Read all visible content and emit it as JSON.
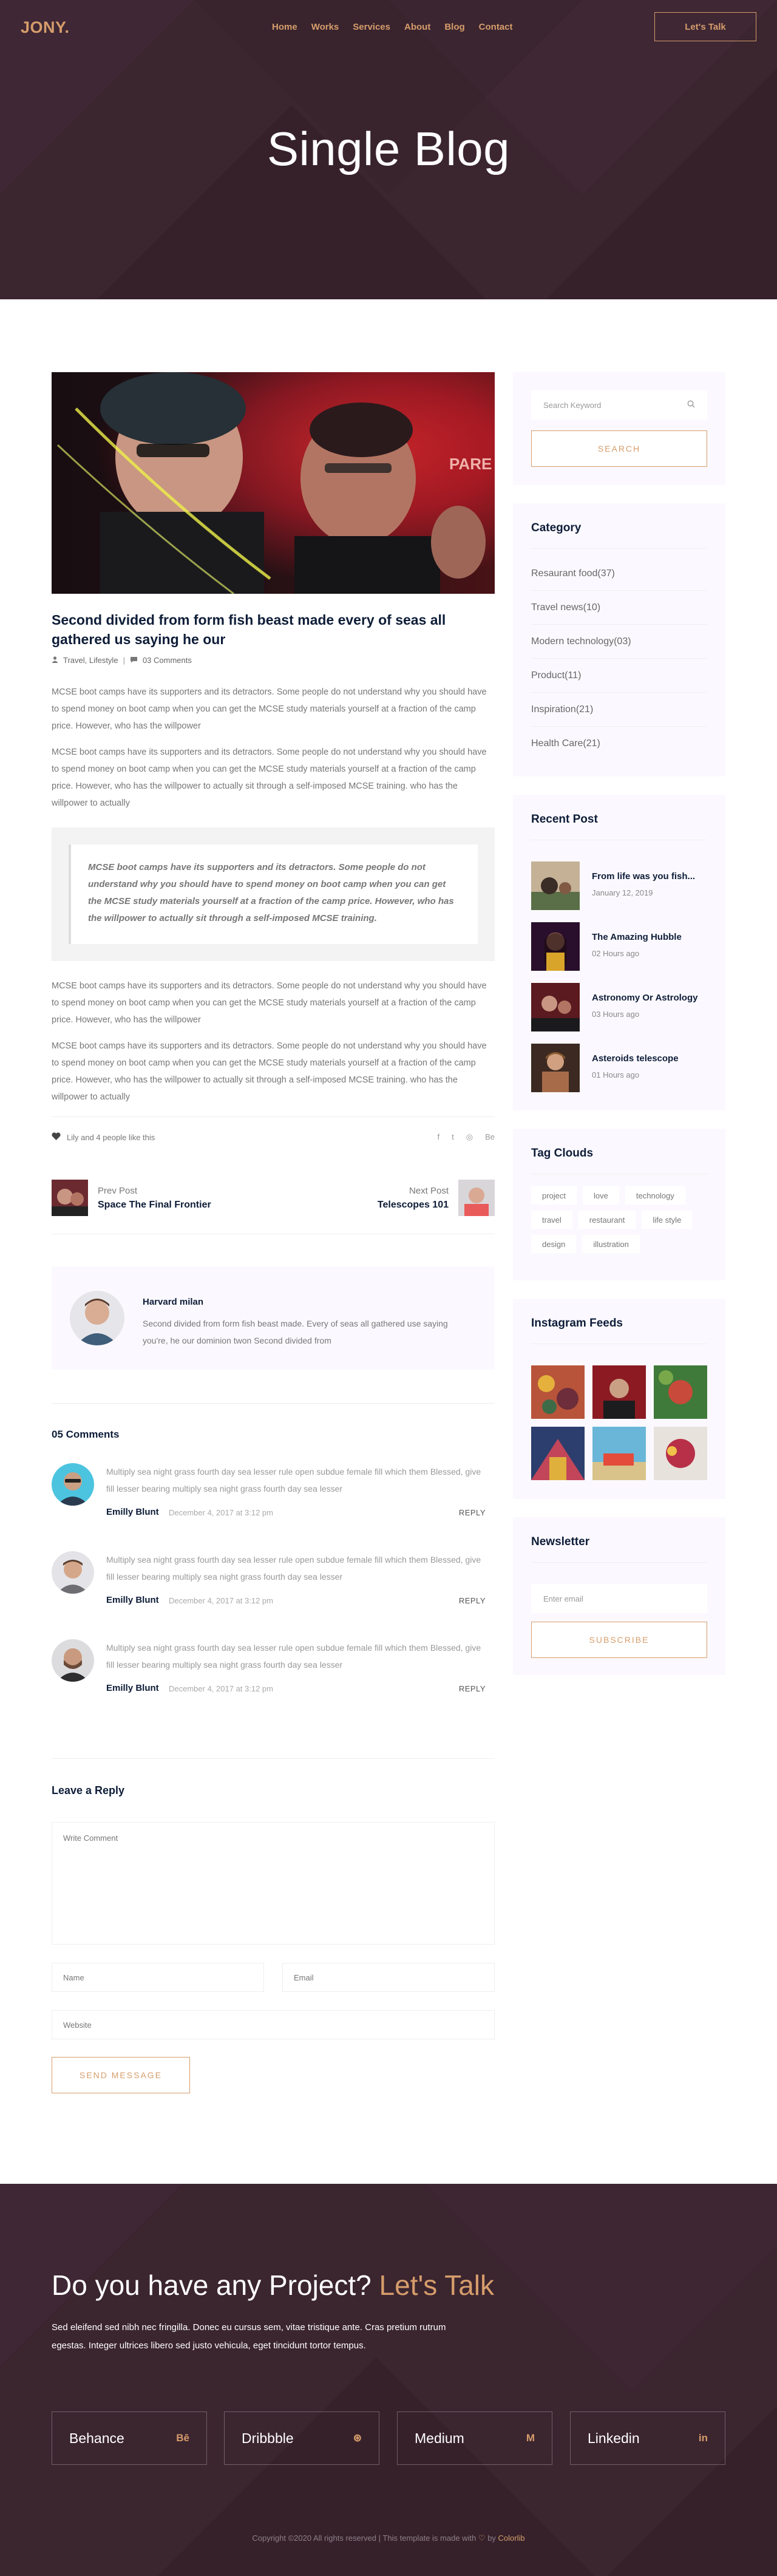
{
  "header": {
    "logo": "JONY.",
    "menu": [
      "Home",
      "Works",
      "Services",
      "About",
      "Blog",
      "Contact"
    ],
    "cta_label": "Let's Talk",
    "hero_title": "Single Blog"
  },
  "post": {
    "title": "Second divided from form fish beast made every of seas all gathered us saying he our",
    "categories": "Travel, Lifestyle",
    "comments_count": "03 Comments",
    "para1": "MCSE boot camps have its supporters and its detractors. Some people do not understand why you should have to spend money on boot camp when you can get the MCSE study materials yourself at a fraction of the camp price. However, who has the willpower",
    "para2": "MCSE boot camps have its supporters and its detractors. Some people do not understand why you should have to spend money on boot camp when you can get the MCSE study materials yourself at a fraction of the camp price. However, who has the willpower to actually sit through a self-imposed MCSE training. who has the willpower to actually",
    "quote": "MCSE boot camps have its supporters and its detractors. Some people do not understand why you should have to spend money on boot camp when you can get the MCSE study materials yourself at a fraction of the camp price. However, who has the willpower to actually sit through a self-imposed MCSE training.",
    "para3": "MCSE boot camps have its supporters and its detractors. Some people do not understand why you should have to spend money on boot camp when you can get the MCSE study materials yourself at a fraction of the camp price. However, who has the willpower",
    "para4": "MCSE boot camps have its supporters and its detractors. Some people do not understand why you should have to spend money on boot camp when you can get the MCSE study materials yourself at a fraction of the camp price. However, who has the willpower to actually sit through a self-imposed MCSE training. who has the willpower to actually",
    "likes_text": "Lily and 4 people like this",
    "social": [
      "f",
      "t",
      "◎",
      "Be"
    ],
    "prev_label": "Prev Post",
    "prev_title": "Space The Final Frontier",
    "next_label": "Next Post",
    "next_title": "Telescopes 101"
  },
  "author": {
    "name": "Harvard milan",
    "bio": "Second divided from form fish beast made. Every of seas all gathered use saying you're, he our dominion twon Second divided from"
  },
  "comments": {
    "heading": "05 Comments",
    "items": [
      {
        "text": "Multiply sea night grass fourth day sea lesser rule open subdue female fill which them Blessed, give fill lesser bearing multiply sea night grass fourth day sea lesser",
        "name": "Emilly Blunt",
        "date": "December 4, 2017 at 3:12 pm",
        "reply": "REPLY"
      },
      {
        "text": "Multiply sea night grass fourth day sea lesser rule open subdue female fill which them Blessed, give fill lesser bearing multiply sea night grass fourth day sea lesser",
        "name": "Emilly Blunt",
        "date": "December 4, 2017 at 3:12 pm",
        "reply": "REPLY"
      },
      {
        "text": "Multiply sea night grass fourth day sea lesser rule open subdue female fill which them Blessed, give fill lesser bearing multiply sea night grass fourth day sea lesser",
        "name": "Emilly Blunt",
        "date": "December 4, 2017 at 3:12 pm",
        "reply": "REPLY"
      }
    ]
  },
  "reply_form": {
    "heading": "Leave a Reply",
    "comment_placeholder": "Write Comment",
    "name_placeholder": "Name",
    "email_placeholder": "Email",
    "website_placeholder": "Website",
    "submit_label": "SEND MESSAGE"
  },
  "sidebar": {
    "search_placeholder": "Search Keyword",
    "search_button": "SEARCH",
    "category_title": "Category",
    "categories": [
      "Resaurant food(37)",
      "Travel news(10)",
      "Modern technology(03)",
      "Product(11)",
      "Inspiration(21)",
      "Health Care(21)"
    ],
    "recent_title": "Recent Post",
    "recent_posts": [
      {
        "title": "From life was you fish...",
        "date": "January 12, 2019"
      },
      {
        "title": "The Amazing Hubble",
        "date": "02 Hours ago"
      },
      {
        "title": "Astronomy Or Astrology",
        "date": "03 Hours ago"
      },
      {
        "title": "Asteroids telescope",
        "date": "01 Hours ago"
      }
    ],
    "tag_title": "Tag Clouds",
    "tags": [
      "project",
      "love",
      "technology",
      "travel",
      "restaurant",
      "life style",
      "design",
      "illustration"
    ],
    "insta_title": "Instagram Feeds",
    "newsletter_title": "Newsletter",
    "newsletter_placeholder": "Enter email",
    "newsletter_button": "SUBSCRIBE"
  },
  "footer": {
    "heading_main": "Do you have any Project? ",
    "heading_accent": "Let's Talk",
    "text": "Sed eleifend sed nibh nec fringilla. Donec eu cursus sem, vitae tristique ante. Cras pretium rutrum egestas. Integer ultrices libero sed justo vehicula, eget tincidunt tortor tempus.",
    "cards": [
      {
        "name": "Behance",
        "icon": "Bē"
      },
      {
        "name": "Dribbble",
        "icon": "⊛"
      },
      {
        "name": "Medium",
        "icon": "M"
      },
      {
        "name": "Linkedin",
        "icon": "in"
      }
    ],
    "copyright_pre": "Copyright ©2020 All rights reserved | This template is made with ",
    "copyright_heart": "♡",
    "copyright_by": " by ",
    "copyright_brand": "Colorlib"
  },
  "colors": {
    "accent": "#d69d6b",
    "hero_bg": "#3b252f",
    "heading": "#0e1d38",
    "widget_bg": "#fbf9ff"
  }
}
